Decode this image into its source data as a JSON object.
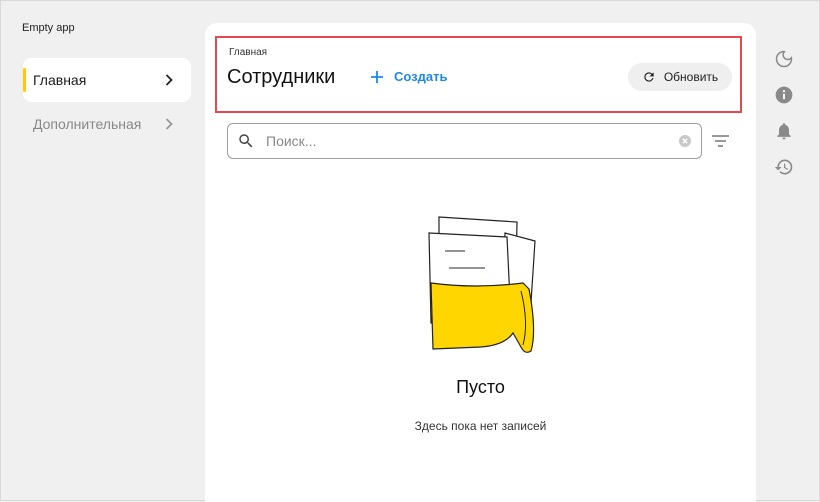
{
  "app": {
    "title": "Empty app"
  },
  "sidebar": {
    "items": [
      {
        "label": "Главная",
        "active": true
      },
      {
        "label": "Дополнительная",
        "active": false
      }
    ]
  },
  "header": {
    "breadcrumb": "Главная",
    "title": "Сотрудники",
    "create_label": "Создать",
    "refresh_label": "Обновить"
  },
  "search": {
    "placeholder": "Поиск...",
    "value": ""
  },
  "empty": {
    "title": "Пусто",
    "subtitle": "Здесь пока нет записей"
  },
  "right_toolbar": {
    "icons": [
      "moon-icon",
      "info-icon",
      "bell-icon",
      "history-icon"
    ]
  },
  "colors": {
    "accent": "#ffcc00",
    "link": "#1e88e5",
    "highlight_border": "#e5484d",
    "background": "#f0f0f0"
  }
}
